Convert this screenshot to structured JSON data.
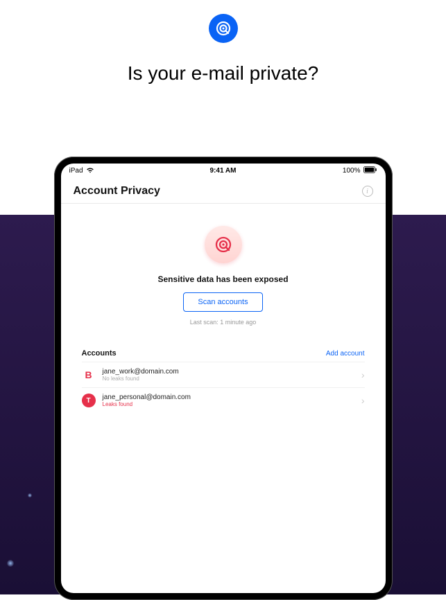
{
  "hero": {
    "title": "Is your e-mail private?"
  },
  "statusbar": {
    "carrier": "iPad",
    "time": "9:41 AM",
    "battery": "100%"
  },
  "screen": {
    "title": "Account Privacy",
    "status_message": "Sensitive data has been exposed",
    "scan_button": "Scan accounts",
    "last_scan": "Last scan: 1 minute ago"
  },
  "accounts_section": {
    "title": "Accounts",
    "add_label": "Add account",
    "items": [
      {
        "avatar_letter": "B",
        "email": "jane_work@domain.com",
        "status": "No leaks found",
        "status_type": "ok"
      },
      {
        "avatar_letter": "T",
        "email": "jane_personal@domain.com",
        "status": "Leaks found",
        "status_type": "leak"
      }
    ]
  }
}
